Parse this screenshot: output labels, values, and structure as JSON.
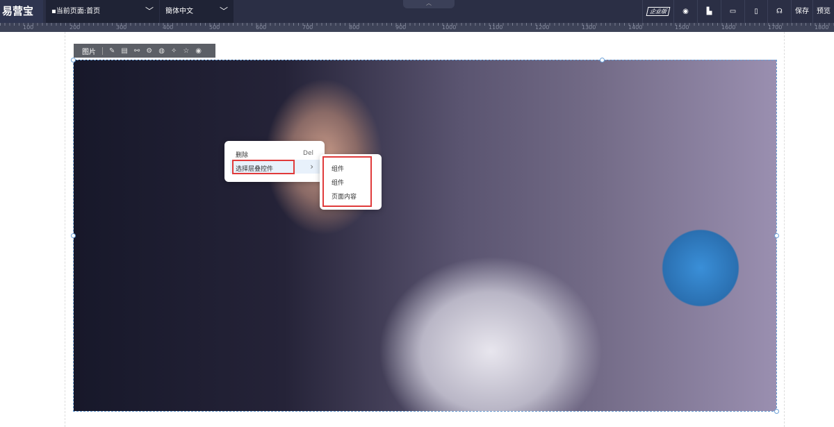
{
  "topbar": {
    "logo": "易营宝",
    "page_select": "当前页面:首页",
    "lang_select": "簡体中文",
    "edition_badge": "企业版",
    "save": "保存",
    "preview": "预览"
  },
  "ruler": {
    "labels": [
      "100",
      "200",
      "300",
      "400",
      "500",
      "600",
      "700",
      "800",
      "900",
      "1000",
      "1100",
      "1200",
      "1300",
      "1400",
      "1500",
      "1600",
      "1700",
      "1800"
    ]
  },
  "toolbar": {
    "label": "图片"
  },
  "context_menu": {
    "items": [
      {
        "label": "删除",
        "shortcut": "Del"
      },
      {
        "label": "选择层叠控件",
        "arrow": "›"
      }
    ]
  },
  "submenu": {
    "items": [
      "组件",
      "组件",
      "页面内容"
    ]
  }
}
